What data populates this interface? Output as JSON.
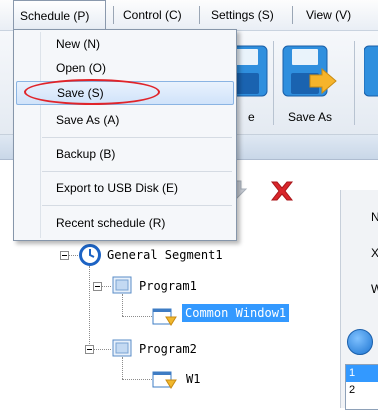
{
  "menubar": {
    "items": [
      {
        "label": "Schedule (P)"
      },
      {
        "label": "Control (C)"
      },
      {
        "label": "Settings (S)"
      },
      {
        "label": "View (V)"
      }
    ]
  },
  "dropdown": {
    "items": [
      {
        "label": "New (N)"
      },
      {
        "label": "Open (O)"
      },
      {
        "label": "Save (S)"
      },
      {
        "label": "Save As (A)"
      },
      {
        "label": "Backup (B)"
      },
      {
        "label": "Export to USB Disk (E)"
      },
      {
        "label": "Recent schedule (R)"
      }
    ]
  },
  "toolbar": {
    "partial_label": "e",
    "save_as_label": "Save As"
  },
  "tree": {
    "nodes": [
      {
        "label": "General Segment1"
      },
      {
        "label": "Program1"
      },
      {
        "label": "Common Window1"
      },
      {
        "label": "Program2"
      },
      {
        "label": "W1"
      }
    ]
  },
  "rightpanel": {
    "labels": [
      "N",
      "X",
      "W"
    ],
    "list": [
      "1",
      "2"
    ]
  },
  "colors": {
    "accent": "#3399ff",
    "highlight_ellipse": "#e0242a",
    "delete_icon": "#d9262b"
  }
}
